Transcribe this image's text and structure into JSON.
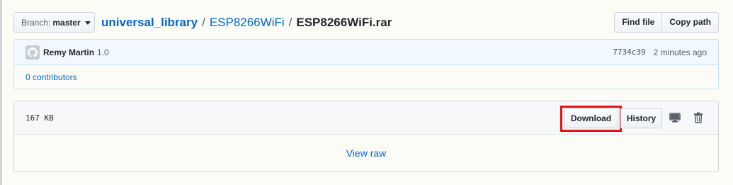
{
  "branch": {
    "label": "Branch:",
    "value": "master"
  },
  "breadcrumb": {
    "repo": "universal_library",
    "folder": "ESP8266WiFi",
    "file": "ESP8266WiFi.rar",
    "separator": "/"
  },
  "file_nav": {
    "find_file": "Find file",
    "copy_path": "Copy path"
  },
  "commit": {
    "author": "Remy Martin",
    "message": "1.0",
    "sha": "7734c39",
    "time_ago": "2 minutes ago",
    "avatar_icon": "github-octocat-icon",
    "contributors": "0 contributors"
  },
  "file": {
    "size": "167 KB",
    "download": "Download",
    "history": "History",
    "desktop_icon": "desktop-icon",
    "trash_icon": "trash-icon",
    "view_raw": "View raw"
  },
  "colors": {
    "link": "#0366d6",
    "highlight": "#e3130f",
    "commit_header_bg": "#f1f8ff"
  }
}
